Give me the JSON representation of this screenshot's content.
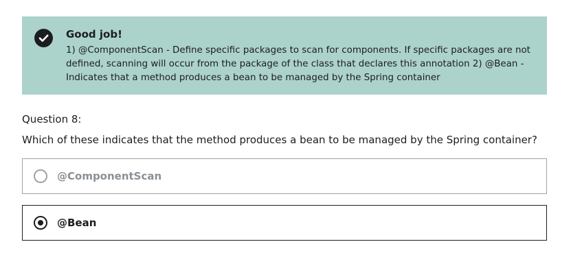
{
  "feedback": {
    "status_icon": "check-circle-icon",
    "title": "Good job!",
    "explanation": "1) @ComponentScan - Define specific packages to scan for components. If specific packages are not defined, scanning will occur from the package of the class that declares this annotation 2) @Bean - Indicates that a method produces a bean to be managed by the Spring container",
    "background_color": "#acd2cc"
  },
  "question": {
    "number_label": "Question 8:",
    "prompt": "Which of these indicates that the method produces a bean to be managed by the Spring container?"
  },
  "answers": [
    {
      "label": "@ComponentScan",
      "selected": false
    },
    {
      "label": "@Bean",
      "selected": true
    }
  ],
  "colors": {
    "text": "#1c1d1f",
    "muted": "#8a9095",
    "border_muted": "#9da3a7"
  }
}
